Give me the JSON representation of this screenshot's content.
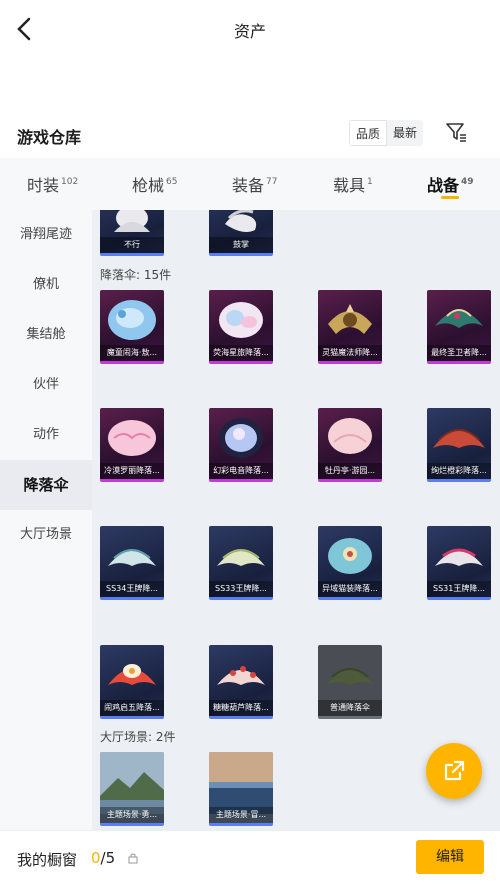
{
  "header": {
    "title": "资产"
  },
  "warehouse": {
    "title": "游戏仓库",
    "sort_quality": "品质",
    "sort_newest": "最新"
  },
  "tabs": [
    {
      "label": "时装",
      "count": "102"
    },
    {
      "label": "枪械",
      "count": "65"
    },
    {
      "label": "装备",
      "count": "77"
    },
    {
      "label": "载具",
      "count": "1"
    },
    {
      "label": "战备",
      "count": "49"
    }
  ],
  "sidebar": {
    "items": [
      {
        "label": "滑翔尾迹"
      },
      {
        "label": "僚机"
      },
      {
        "label": "集结舱"
      },
      {
        "label": "伙伴"
      },
      {
        "label": "动作"
      },
      {
        "label": "降落伞"
      },
      {
        "label": "大厅场景"
      }
    ]
  },
  "actions_partial": [
    {
      "name": "不行"
    },
    {
      "name": "鼓掌"
    }
  ],
  "parachute_section": {
    "title": "降落伞: 15件"
  },
  "parachutes": [
    {
      "name": "魔童闹海·敖...",
      "rarity": "purple"
    },
    {
      "name": "荧海星旅降落...",
      "rarity": "purple"
    },
    {
      "name": "灵猫魔法师降...",
      "rarity": "purple"
    },
    {
      "name": "最终圣卫者降...",
      "rarity": "purple"
    },
    {
      "name": "冷漠罗丽降落...",
      "rarity": "purple"
    },
    {
      "name": "幻彩电音降落...",
      "rarity": "purple"
    },
    {
      "name": "牡丹亭·游园...",
      "rarity": "purple"
    },
    {
      "name": "绚烂橙彩降落...",
      "rarity": "blue"
    },
    {
      "name": "SS34王牌降...",
      "rarity": "blue"
    },
    {
      "name": "SS33王牌降...",
      "rarity": "blue"
    },
    {
      "name": "异域猫装降落...",
      "rarity": "blue"
    },
    {
      "name": "SS31王牌降...",
      "rarity": "blue"
    },
    {
      "name": "闹鸡启五降落...",
      "rarity": "blue"
    },
    {
      "name": "糖糖葫芦降落...",
      "rarity": "blue"
    },
    {
      "name": "普通降落伞",
      "rarity": "gray"
    }
  ],
  "scene_section": {
    "title": "大厅场景: 2件"
  },
  "scenes": [
    {
      "name": "主题场景·勇..."
    },
    {
      "name": "主题场景·冒..."
    }
  ],
  "footer": {
    "label": "我的橱窗",
    "count_current": "0",
    "count_total": "/5",
    "edit_label": "编辑"
  },
  "colors": {
    "accent": "#ffb400",
    "purple_rarity": "#c23ad8",
    "blue_rarity": "#5a7df0"
  }
}
